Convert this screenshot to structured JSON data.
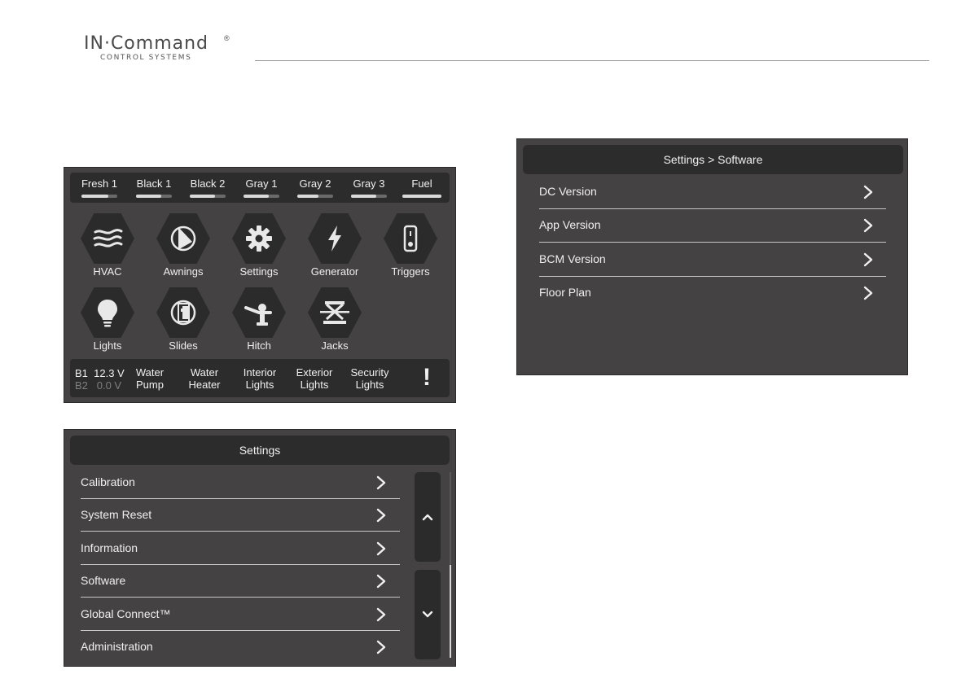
{
  "brand": {
    "main": "IN·Command",
    "reg": "®",
    "sub": "CONTROL SYSTEMS"
  },
  "home": {
    "tanks": [
      {
        "label": "Fresh 1",
        "level": 0.75
      },
      {
        "label": "Black 1",
        "level": 0.7
      },
      {
        "label": "Black 2",
        "level": 0.7
      },
      {
        "label": "Gray 1",
        "level": 0.7
      },
      {
        "label": "Gray 2",
        "level": 0.6
      },
      {
        "label": "Gray 3",
        "level": 0.7
      },
      {
        "label": "Fuel",
        "level": 1.0
      }
    ],
    "apps": [
      {
        "label": "HVAC",
        "icon": "hvac-icon"
      },
      {
        "label": "Awnings",
        "icon": "awning-icon"
      },
      {
        "label": "Settings",
        "icon": "gear-icon"
      },
      {
        "label": "Generator",
        "icon": "lightning-icon"
      },
      {
        "label": "Triggers",
        "icon": "switch-icon"
      },
      {
        "label": "Lights",
        "icon": "lightbulb-icon"
      },
      {
        "label": "Slides",
        "icon": "slide-icon"
      },
      {
        "label": "Hitch",
        "icon": "hitch-icon"
      },
      {
        "label": "Jacks",
        "icon": "jack-icon"
      }
    ],
    "battery": {
      "b1_label": "B1",
      "b1_value": "12.3 V",
      "b2_label": "B2",
      "b2_value": "0.0 V"
    },
    "quick": [
      {
        "line1": "Water",
        "line2": "Pump"
      },
      {
        "line1": "Water",
        "line2": "Heater"
      },
      {
        "line1": "Interior",
        "line2": "Lights"
      },
      {
        "line1": "Exterior",
        "line2": "Lights"
      },
      {
        "line1": "Security",
        "line2": "Lights"
      }
    ],
    "alert": "!"
  },
  "settings": {
    "title": "Settings",
    "items": [
      {
        "label": "Calibration"
      },
      {
        "label": "System Reset"
      },
      {
        "label": "Information"
      },
      {
        "label": "Software"
      },
      {
        "label": "Global Connect™"
      },
      {
        "label": "Administration"
      }
    ]
  },
  "software": {
    "title": "Settings > Software",
    "items": [
      {
        "label": "DC Version"
      },
      {
        "label": "App Version"
      },
      {
        "label": "BCM Version"
      },
      {
        "label": "Floor Plan"
      }
    ]
  },
  "colors": {
    "panel": "#444242",
    "bar": "#2d2c2c",
    "text": "#f0f0f0",
    "divider": "#c8c8c8"
  }
}
